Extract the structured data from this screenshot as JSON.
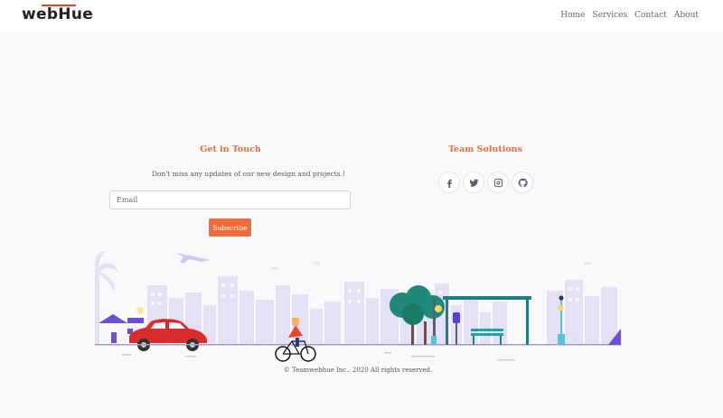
{
  "header": {
    "logo": "webHue",
    "nav": [
      {
        "label": "Home"
      },
      {
        "label": "Services"
      },
      {
        "label": "Contact"
      },
      {
        "label": "About"
      }
    ]
  },
  "newsletter": {
    "title": "Get in Touch",
    "subtext": "Don't miss any updates of our new design and projects.!",
    "email_placeholder": "Email",
    "subscribe_label": "Subscribe"
  },
  "team": {
    "title": "Team Solutions",
    "socials": [
      {
        "icon": "facebook-icon"
      },
      {
        "icon": "twitter-icon"
      },
      {
        "icon": "instagram-icon"
      },
      {
        "icon": "github-icon"
      }
    ]
  },
  "footer": {
    "copyright": "© Teamwebhue Inc.. 2020 All rights reserved."
  },
  "colors": {
    "accent": "#f26b3a",
    "background": "#f9f9fc",
    "city": "#e4e1f6",
    "car": "#d92d2d",
    "tree": "#1f8a78"
  }
}
